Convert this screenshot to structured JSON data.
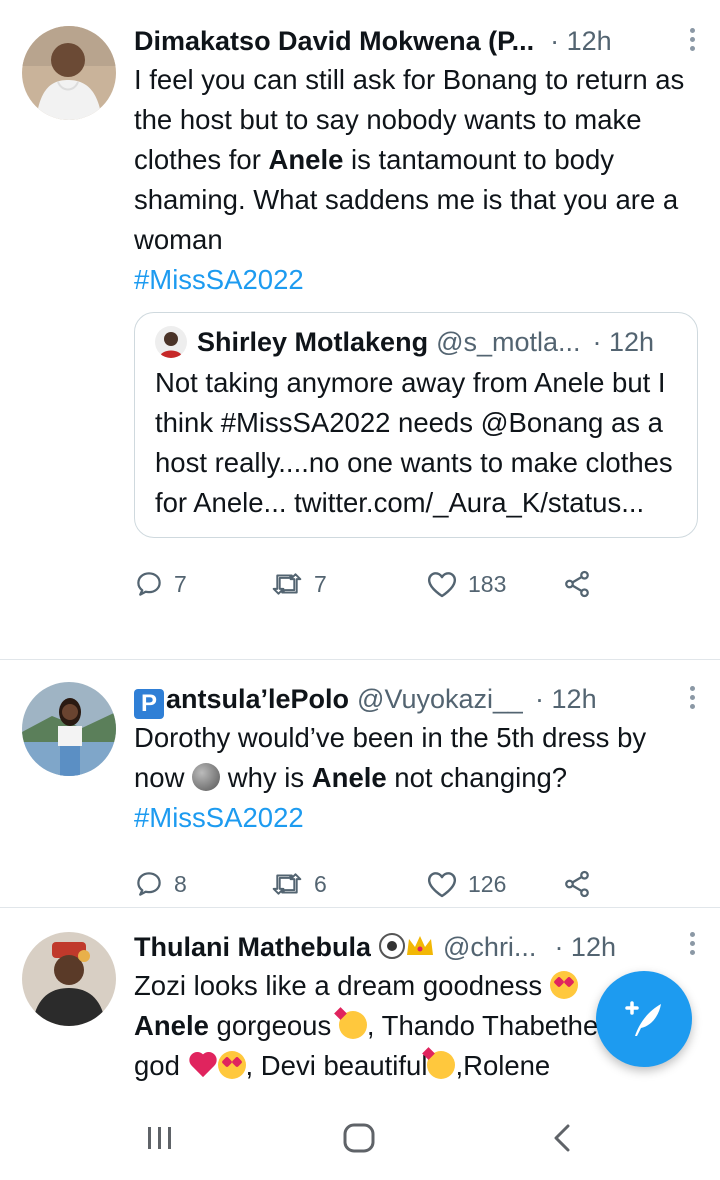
{
  "tweets": [
    {
      "name": "Dimakatso David Mokwena (P...",
      "time": "· 12h",
      "text_parts": [
        "I feel you can still ask for Bonang to return as the host but to say nobody wants to make clothes for ",
        "Anele",
        " is tantamount to body shaming. What saddens me is that you are a woman"
      ],
      "hashtag": "#MissSA2022",
      "quote": {
        "name": "Shirley Motlakeng",
        "handle": "@s_motla...",
        "time": "· 12h",
        "text": "Not taking anymore away from Anele but I think #MissSA2022 needs @Bonang as a host really....no one wants to make clothes for Anele... twitter.com/_Aura_K/status..."
      },
      "replies": "7",
      "retweets": "7",
      "likes": "183"
    },
    {
      "name_badge": "P",
      "name": "antsula’lePolo",
      "handle": "@Vuyokazi__",
      "time": "· 12h",
      "text_parts": [
        "Dorothy would’ve been in the 5th dress by now ",
        " why is ",
        "Anele",
        " not changing?"
      ],
      "hashtag": "#MissSA2022",
      "replies": "8",
      "retweets": "6",
      "likes": "126"
    },
    {
      "name": "Thulani Mathebula",
      "handle": "@chri...",
      "time": "· 12h",
      "text_parts": [
        "Zozi looks like a dream goodness ",
        "Anele",
        " gorgeous ",
        ", Thando Thabethe ",
        "god ",
        ", Devi beautiful",
        ",Rolene"
      ]
    }
  ],
  "colors": {
    "accent": "#1d9bf0",
    "secondary_text": "#536471",
    "border": "#e1e6ea"
  },
  "icons": {
    "reply": "reply-icon",
    "retweet": "retweet-icon",
    "like": "heart-icon",
    "share": "share-icon",
    "compose": "compose-tweet-icon",
    "nav_recents": "recent-apps-icon",
    "nav_home": "home-icon",
    "nav_back": "back-icon"
  }
}
